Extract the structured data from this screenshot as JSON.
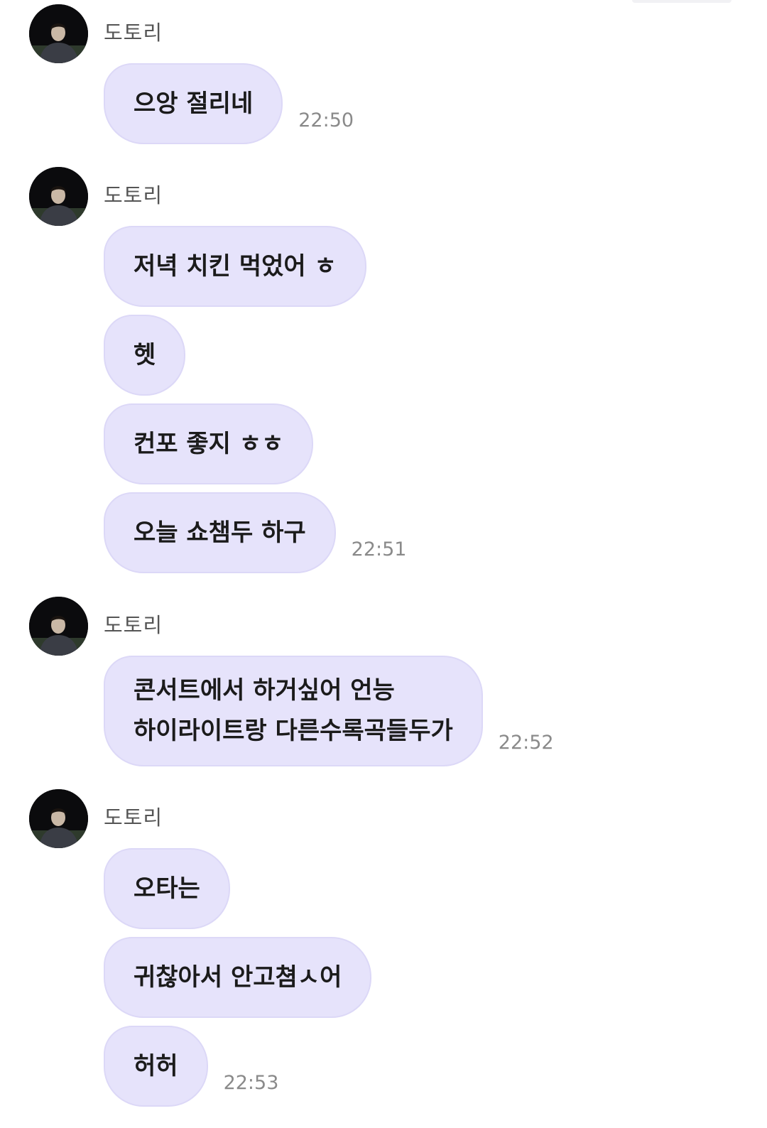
{
  "chat": {
    "groups": [
      {
        "sender": "도토리",
        "messages": [
          {
            "text": "으앙 절리네",
            "time": "22:50"
          }
        ]
      },
      {
        "sender": "도토리",
        "messages": [
          {
            "text": "저녁 치킨 먹었어 ㅎ"
          },
          {
            "text": "헷"
          },
          {
            "text": "컨포 좋지 ㅎㅎ"
          },
          {
            "text": "오늘 쇼챔두 하구",
            "time": "22:51"
          }
        ]
      },
      {
        "sender": "도토리",
        "messages": [
          {
            "lines": [
              "콘서트에서 하거싶어 언능",
              "하이라이트랑 다른수록곡들두가"
            ],
            "time": "22:52"
          }
        ]
      },
      {
        "sender": "도토리",
        "messages": [
          {
            "text": "오타는"
          },
          {
            "text": "귀찮아서 안고쳠ㅅ어"
          },
          {
            "text": "허허",
            "time": "22:53"
          }
        ]
      }
    ],
    "avatar_icon": "profile-photo-person",
    "colors": {
      "bubble_bg": "#e6e3fb",
      "bubble_border": "#dcd8f7",
      "sender_text": "#555555",
      "time_text": "#8a8a8a",
      "message_text": "#1b1b1b"
    }
  }
}
